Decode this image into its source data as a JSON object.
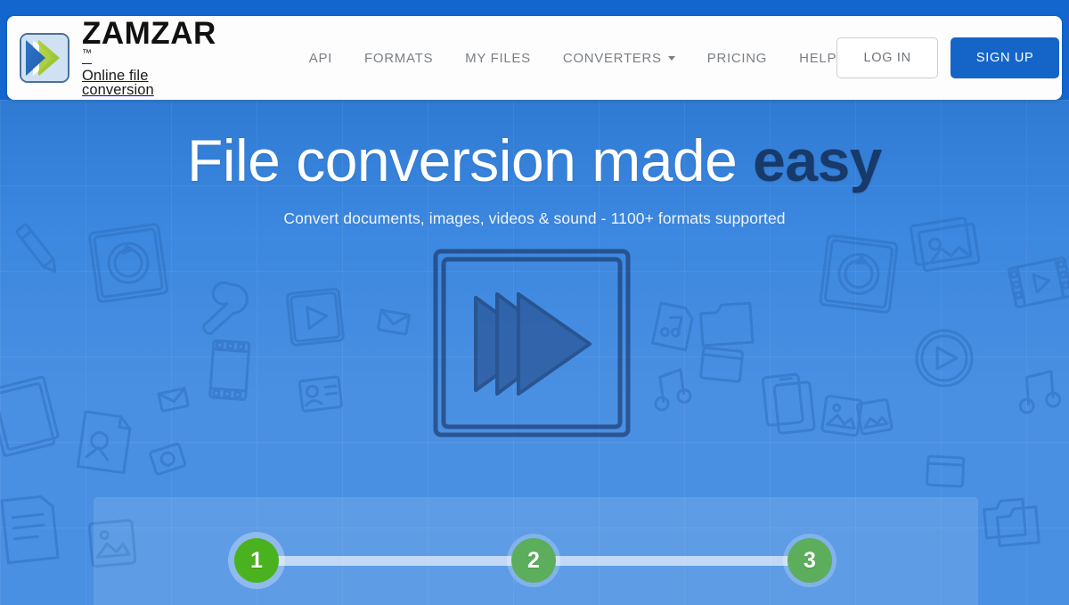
{
  "brand": {
    "name": "ZAMZAR",
    "trademark": "™",
    "tagline": "Online file conversion",
    "logo_icon": "double-chevron-logo-icon"
  },
  "nav": {
    "items": [
      {
        "label": "API",
        "has_dropdown": false
      },
      {
        "label": "FORMATS",
        "has_dropdown": false
      },
      {
        "label": "MY FILES",
        "has_dropdown": false
      },
      {
        "label": "CONVERTERS",
        "has_dropdown": true
      },
      {
        "label": "PRICING",
        "has_dropdown": false
      },
      {
        "label": "HELP",
        "has_dropdown": false
      }
    ]
  },
  "header_actions": {
    "login_label": "LOG IN",
    "signup_label": "SIGN UP"
  },
  "hero": {
    "headline_main": "File conversion made ",
    "headline_accent": "easy",
    "subhead": "Convert documents, images, videos & sound - 1100+ formats supported",
    "illustration": "sketch-fast-forward-play-icon"
  },
  "wizard": {
    "steps": [
      {
        "number": "1",
        "state": "active"
      },
      {
        "number": "2",
        "state": "inactive"
      },
      {
        "number": "3",
        "state": "inactive"
      }
    ]
  },
  "colors": {
    "brand_blue": "#1565c8",
    "hero_blue": "#4a90e2",
    "page_blue": "#1466cf",
    "step_active_green": "#4bb21f",
    "step_inactive_green": "#5cae5c",
    "accent_navy": "#173a6b",
    "nav_grey": "#7b7f85",
    "header_white": "#fdfdfd"
  }
}
